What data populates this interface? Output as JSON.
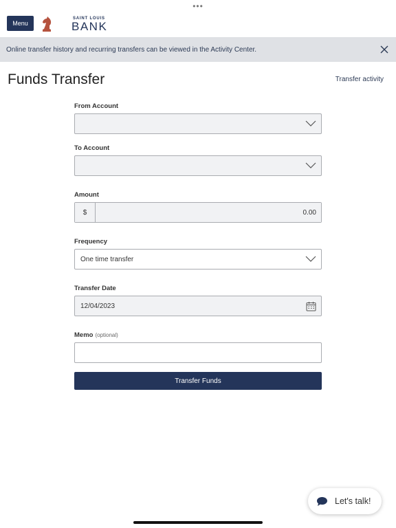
{
  "top_dots": "•••",
  "header": {
    "menu_label": "Menu",
    "logo_small": "SAINT LOUIS",
    "logo_big": "BANK",
    "brand_colors": {
      "navy": "#24355a",
      "logo_red": "#b5533f"
    }
  },
  "banner": {
    "text": "Online transfer history and recurring transfers can be viewed in the Activity Center.",
    "close_icon": "close-icon"
  },
  "page": {
    "title": "Funds Transfer",
    "activity_link": "Transfer activity"
  },
  "form": {
    "from_account": {
      "label": "From Account",
      "value": ""
    },
    "to_account": {
      "label": "To Account",
      "value": ""
    },
    "amount": {
      "label": "Amount",
      "currency": "$",
      "value": "0.00"
    },
    "frequency": {
      "label": "Frequency",
      "value": "One time transfer"
    },
    "transfer_date": {
      "label": "Transfer Date",
      "value": "12/04/2023"
    },
    "memo": {
      "label": "Memo",
      "optional": "(optional)",
      "value": ""
    },
    "submit_label": "Transfer Funds"
  },
  "chat": {
    "label": "Let's talk!",
    "icon": "chat-bubble-icon"
  }
}
